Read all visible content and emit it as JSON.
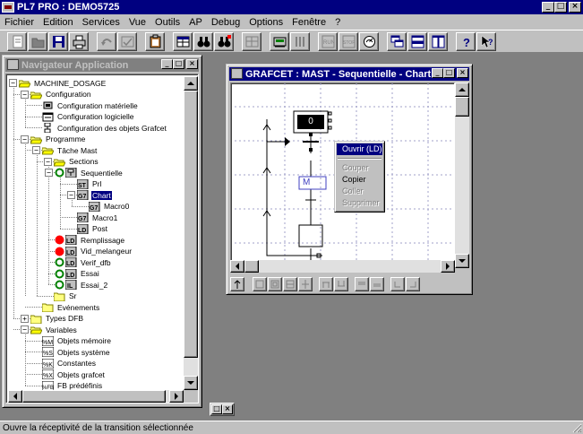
{
  "app": {
    "title": "PL7 PRO : DEMO5725",
    "controls": {
      "minimize": "_",
      "maximize": "□",
      "close": "×"
    }
  },
  "menu": [
    {
      "id": "fichier",
      "label": "Fichier"
    },
    {
      "id": "edition",
      "label": "Edition"
    },
    {
      "id": "services",
      "label": "Services"
    },
    {
      "id": "vue",
      "label": "Vue"
    },
    {
      "id": "outils",
      "label": "Outils"
    },
    {
      "id": "ap",
      "label": "AP"
    },
    {
      "id": "debug",
      "label": "Debug"
    },
    {
      "id": "options",
      "label": "Options"
    },
    {
      "id": "fenetre",
      "label": "Fenêtre"
    },
    {
      "id": "help",
      "label": "?"
    }
  ],
  "toolbar": {
    "buttons": [
      {
        "name": "new-document",
        "icon": "new-document-icon",
        "disabled": true
      },
      {
        "name": "open",
        "icon": "open-folder-icon",
        "disabled": true
      },
      {
        "name": "save",
        "icon": "save-disk-icon",
        "disabled": false
      },
      {
        "name": "print",
        "icon": "printer-icon",
        "disabled": false
      },
      {
        "gap": true
      },
      {
        "name": "undo",
        "icon": "undo-icon",
        "disabled": true
      },
      {
        "name": "validate",
        "icon": "check-icon",
        "disabled": true
      },
      {
        "gap": true
      },
      {
        "name": "cut-paste",
        "icon": "clipboard-icon",
        "disabled": false
      },
      {
        "gap": true
      },
      {
        "name": "variables",
        "icon": "table-icon",
        "disabled": false
      },
      {
        "name": "find",
        "icon": "binoculars-icon",
        "disabled": false
      },
      {
        "name": "replace",
        "icon": "replace-icon",
        "disabled": false
      },
      {
        "gap": true
      },
      {
        "name": "grid",
        "icon": "grid-icon",
        "disabled": true
      },
      {
        "gap": true
      },
      {
        "name": "plc-connect",
        "icon": "plc-icon",
        "disabled": false
      },
      {
        "name": "plc-transfer",
        "icon": "bars-icon",
        "disabled": true
      },
      {
        "gap": true
      },
      {
        "name": "run",
        "icon": "run-icon",
        "disabled": true
      },
      {
        "name": "stop",
        "icon": "stop-icon",
        "disabled": true
      },
      {
        "name": "animation",
        "icon": "animation-icon",
        "disabled": false
      },
      {
        "gap": true
      },
      {
        "name": "window-cascade",
        "icon": "window-cascade-icon",
        "disabled": false
      },
      {
        "name": "window-horizontal",
        "icon": "window-horizontal-icon",
        "disabled": false
      },
      {
        "name": "window-vertical",
        "icon": "window-vertical-icon",
        "disabled": false
      },
      {
        "gap": true
      },
      {
        "name": "help",
        "icon": "help-icon",
        "disabled": false
      },
      {
        "name": "context-help",
        "icon": "context-help-icon",
        "disabled": false
      }
    ]
  },
  "navigator": {
    "title": "Navigateur Application",
    "tree": [
      {
        "label": "MACHINE_DOSAGE",
        "depth": 0,
        "icon": "folder-open-icon",
        "expander": "minus"
      },
      {
        "label": "Configuration",
        "depth": 1,
        "icon": "folder-open-icon",
        "expander": "minus"
      },
      {
        "label": "Configuration matérielle",
        "depth": 2,
        "icon": "hardware-icon"
      },
      {
        "label": "Configuration logicielle",
        "depth": 2,
        "icon": "software-icon"
      },
      {
        "label": "Configuration des objets Grafcet",
        "depth": 2,
        "icon": "grafcet-config-icon"
      },
      {
        "label": "Programme",
        "depth": 1,
        "icon": "folder-open-icon",
        "expander": "minus"
      },
      {
        "label": "Tâche Mast",
        "depth": 2,
        "icon": "folder-open-icon",
        "expander": "minus"
      },
      {
        "label": "Sections",
        "depth": 3,
        "icon": "folder-open-icon",
        "expander": "minus"
      },
      {
        "label": "Sequentielle",
        "depth": 4,
        "icon": "sfc-section-icon",
        "status": "green-ring",
        "expander": "minus"
      },
      {
        "label": "Prl",
        "depth": 5,
        "icon": "st-icon"
      },
      {
        "label": "Chart",
        "depth": 5,
        "icon": "chart-icon",
        "expander": "minus"
      },
      {
        "label": "Macro0",
        "depth": 6,
        "icon": "chart-icon"
      },
      {
        "label": "Macro1",
        "depth": 5,
        "icon": "chart-icon"
      },
      {
        "label": "Post",
        "depth": 5,
        "icon": "ld-icon"
      },
      {
        "label": "Remplissage",
        "depth": 4,
        "icon": "ld-icon",
        "status": "red"
      },
      {
        "label": "Vid_melangeur",
        "depth": 4,
        "icon": "ld-icon",
        "status": "red"
      },
      {
        "label": "Verif_dfb",
        "depth": 4,
        "icon": "ld-icon",
        "status": "green-ring"
      },
      {
        "label": "Essai",
        "depth": 4,
        "icon": "ld-icon",
        "status": "green-ring"
      },
      {
        "label": "Essai_2",
        "depth": 4,
        "icon": "il-icon",
        "status": "green-ring"
      },
      {
        "label": "Sr",
        "depth": 3,
        "icon": "folder-closed-icon"
      },
      {
        "label": "Evénements",
        "depth": 2,
        "icon": "folder-closed-icon"
      },
      {
        "label": "Types DFB",
        "depth": 1,
        "icon": "folder-closed-icon",
        "expander": "plus"
      },
      {
        "label": "Variables",
        "depth": 1,
        "icon": "folder-open-icon",
        "expander": "minus"
      },
      {
        "label": "Objets mémoire",
        "depth": 2,
        "icon": "var-m-icon"
      },
      {
        "label": "Objets système",
        "depth": 2,
        "icon": "var-s-icon"
      },
      {
        "label": "Constantes",
        "depth": 2,
        "icon": "var-k-icon"
      },
      {
        "label": "Objets grafcet",
        "depth": 2,
        "icon": "var-x-icon"
      },
      {
        "label": "FB prédéfinis",
        "depth": 2,
        "icon": "var-fb-icon"
      }
    ],
    "selected_index": 10
  },
  "grafcet": {
    "title": "GRAFCET : MAST - Sequentielle - Chart",
    "step_number": "0",
    "step_label_partial": "M"
  },
  "context_menu": {
    "items": [
      {
        "label": "Ouvrir (LD)",
        "state": "highlighted"
      },
      {
        "separator": true
      },
      {
        "label": "Couper",
        "state": "disabled"
      },
      {
        "label": "Copier",
        "state": "enabled"
      },
      {
        "label": "Coller",
        "state": "disabled"
      },
      {
        "label": "Supprimer",
        "state": "disabled"
      }
    ]
  },
  "statusbar": {
    "text": "Ouvre la réceptivité de la transition sélectionnée"
  },
  "colors": {
    "active_title": "#000080",
    "inactive_title": "#808080",
    "face": "#c0c0c0",
    "workspace": "#808080",
    "status_red": "#ff0000",
    "status_green": "#008000",
    "grid_line": "#9999cc"
  }
}
